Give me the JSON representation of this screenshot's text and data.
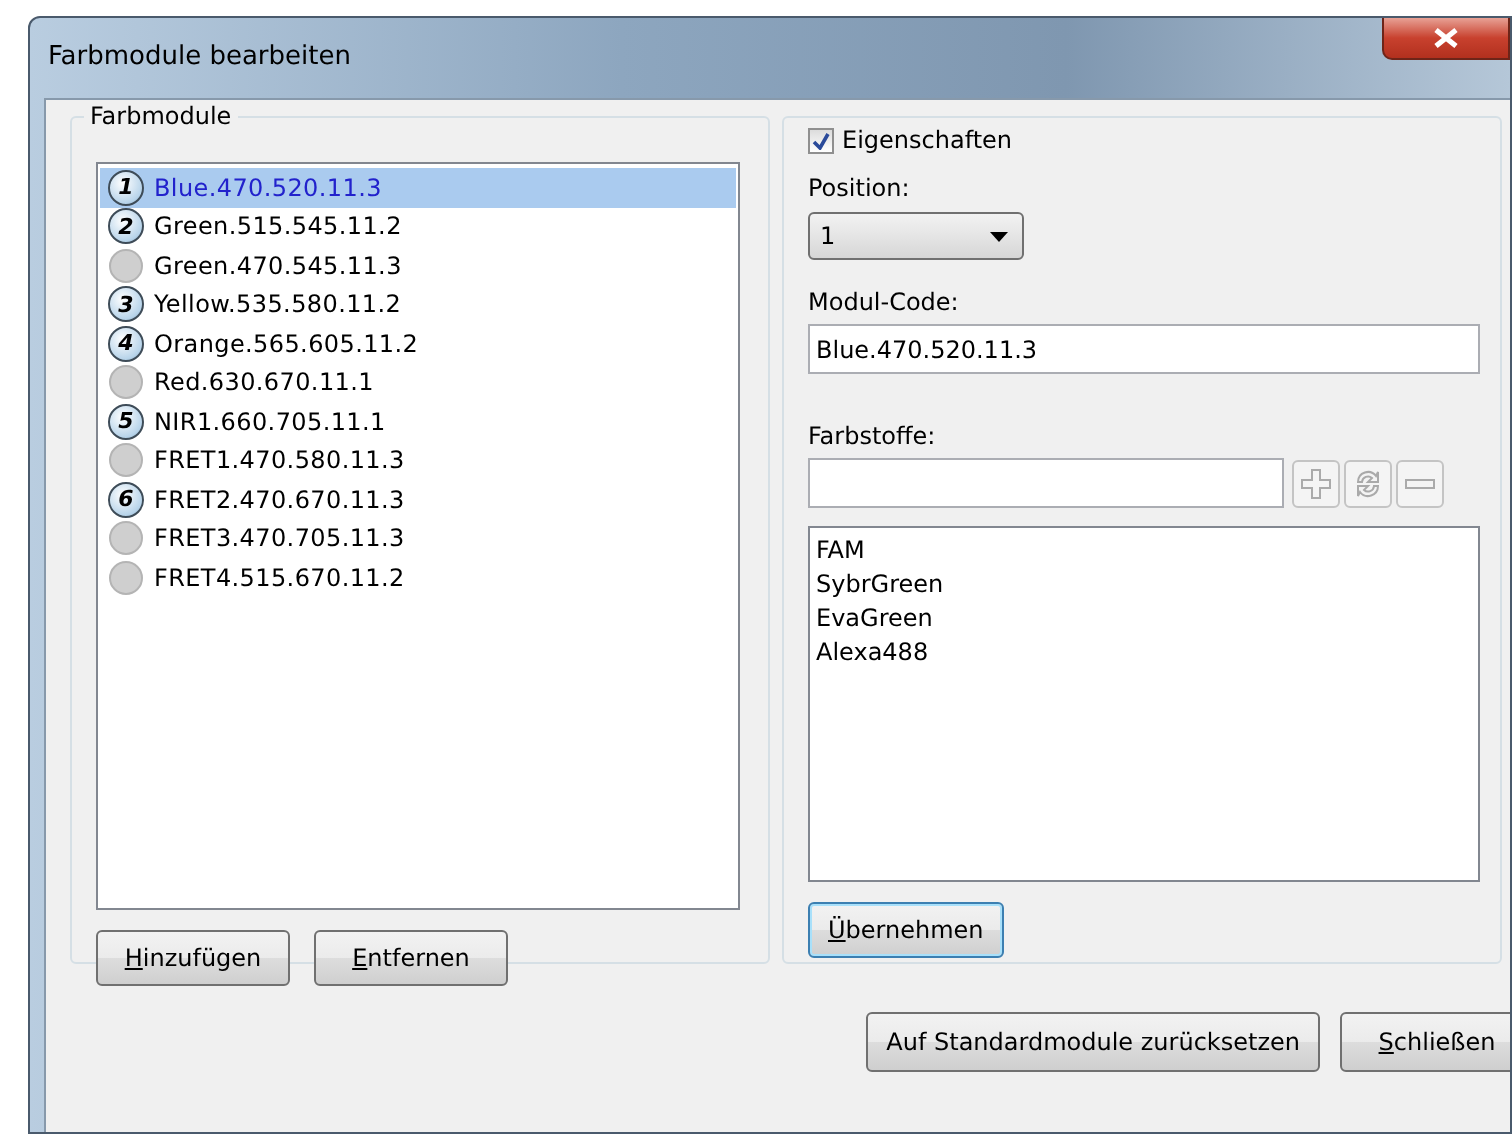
{
  "window": {
    "title": "Farbmodule bearbeiten"
  },
  "modules": {
    "title": "Farbmodule",
    "items": [
      {
        "label": "Blue.470.520.11.3",
        "number": "1",
        "selected": true
      },
      {
        "label": "Green.515.545.11.2",
        "number": "2",
        "selected": false
      },
      {
        "label": "Green.470.545.11.3",
        "selected": false
      },
      {
        "label": "Yellow.535.580.11.2",
        "number": "3",
        "selected": false
      },
      {
        "label": "Orange.565.605.11.2",
        "number": "4",
        "selected": false
      },
      {
        "label": "Red.630.670.11.1",
        "selected": false
      },
      {
        "label": "NIR1.660.705.11.1",
        "number": "5",
        "selected": false
      },
      {
        "label": "FRET1.470.580.11.3",
        "selected": false
      },
      {
        "label": "FRET2.470.670.11.3",
        "number": "6",
        "selected": false
      },
      {
        "label": "FRET3.470.705.11.3",
        "selected": false
      },
      {
        "label": "FRET4.515.670.11.2",
        "selected": false
      }
    ],
    "buttons": [
      {
        "label": "Hinzufügen",
        "mnemonic": true
      },
      {
        "label": "Entfernen",
        "mnemonic": true
      }
    ]
  },
  "properties": {
    "label": "Eigenschaften",
    "checked": true,
    "position_label": "Position:",
    "position_value": "1",
    "code_label": "Modul-Code:",
    "code_value": "Blue.470.520.11.3",
    "dyes_label": "Farbstoffe:",
    "dyes": [
      "FAM",
      "SybrGreen",
      "EvaGreen",
      "Alexa488"
    ],
    "apply_button": {
      "label": "Übernehmen",
      "mnemonic": true,
      "focused": true
    }
  },
  "buttons": [
    {
      "label": "Auf Standardmodule zurücksetzen",
      "mnemonic": false
    },
    {
      "label": "Schließen",
      "mnemonic": true
    }
  ]
}
